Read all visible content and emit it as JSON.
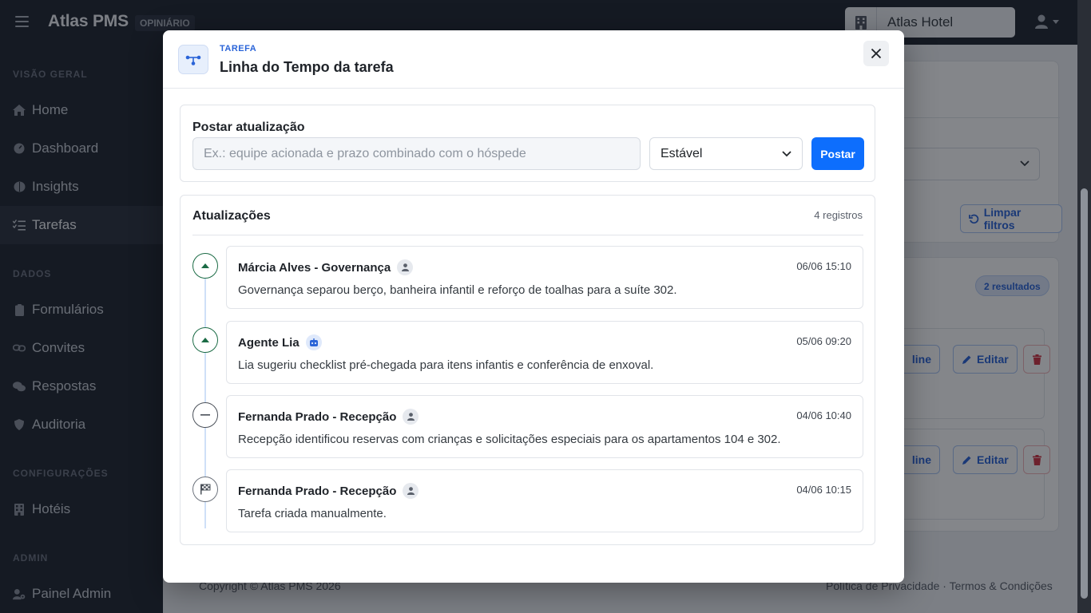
{
  "app": {
    "brand": "Atlas PMS",
    "brand_badge": "OPINIÁRIO",
    "hotel_name": "Atlas Hotel"
  },
  "sidebar": {
    "sections": [
      {
        "title": "VISÃO GERAL"
      },
      {
        "title": "DADOS"
      },
      {
        "title": "CONFIGURAÇÕES"
      },
      {
        "title": "ADMIN"
      }
    ],
    "items": [
      {
        "label": "Home",
        "icon": "home-icon"
      },
      {
        "label": "Dashboard",
        "icon": "gauge-icon"
      },
      {
        "label": "Insights",
        "icon": "brain-icon"
      },
      {
        "label": "Tarefas",
        "icon": "task-list-icon",
        "active": true
      },
      {
        "label": "Formulários",
        "icon": "clipboard-icon"
      },
      {
        "label": "Convites",
        "icon": "link-icon"
      },
      {
        "label": "Respostas",
        "icon": "comments-icon"
      },
      {
        "label": "Auditoria",
        "icon": "shield-icon"
      },
      {
        "label": "Hotéis",
        "icon": "building-icon"
      },
      {
        "label": "Painel Admin",
        "icon": "user-gear-icon"
      }
    ]
  },
  "background": {
    "clear_filters": "Limpar filtros",
    "results_badge": "2 resultados",
    "edit_label": "Editar",
    "timeline_fragment": "line",
    "footer_copyright": "Copyright © Atlas PMS 2026",
    "footer_links": "Política de Privacidade · Termos & Condições"
  },
  "modal": {
    "eyebrow": "TAREFA",
    "title": "Linha do Tempo da tarefa",
    "post": {
      "label": "Postar atualização",
      "placeholder": "Ex.: equipe acionada e prazo combinado com o hóspede",
      "status_value": "Estável",
      "submit_label": "Postar"
    },
    "updates": {
      "title": "Atualizações",
      "count": "4 registros",
      "entries": [
        {
          "author": "Márcia Alves - Governança",
          "author_type": "person",
          "time": "06/06 15:10",
          "text": "Governança separou berço, banheira infantil e reforço de toalhas para a suíte 302.",
          "marker": "up"
        },
        {
          "author": "Agente Lia",
          "author_type": "bot",
          "time": "05/06 09:20",
          "text": "Lia sugeriu checklist pré-chegada para itens infantis e conferência de enxoval.",
          "marker": "up"
        },
        {
          "author": "Fernanda Prado - Recepção",
          "author_type": "person",
          "time": "04/06 10:40",
          "text": "Recepção identificou reservas com crianças e solicitações especiais para os apartamentos 104 e 302.",
          "marker": "flat"
        },
        {
          "author": "Fernanda Prado - Recepção",
          "author_type": "person",
          "time": "04/06 10:15",
          "text": "Tarefa criada manualmente.",
          "marker": "flag"
        }
      ]
    }
  },
  "colors": {
    "primary": "#0d6efd",
    "sidebar_bg": "#212631",
    "trend_up": "#1b6b45"
  }
}
